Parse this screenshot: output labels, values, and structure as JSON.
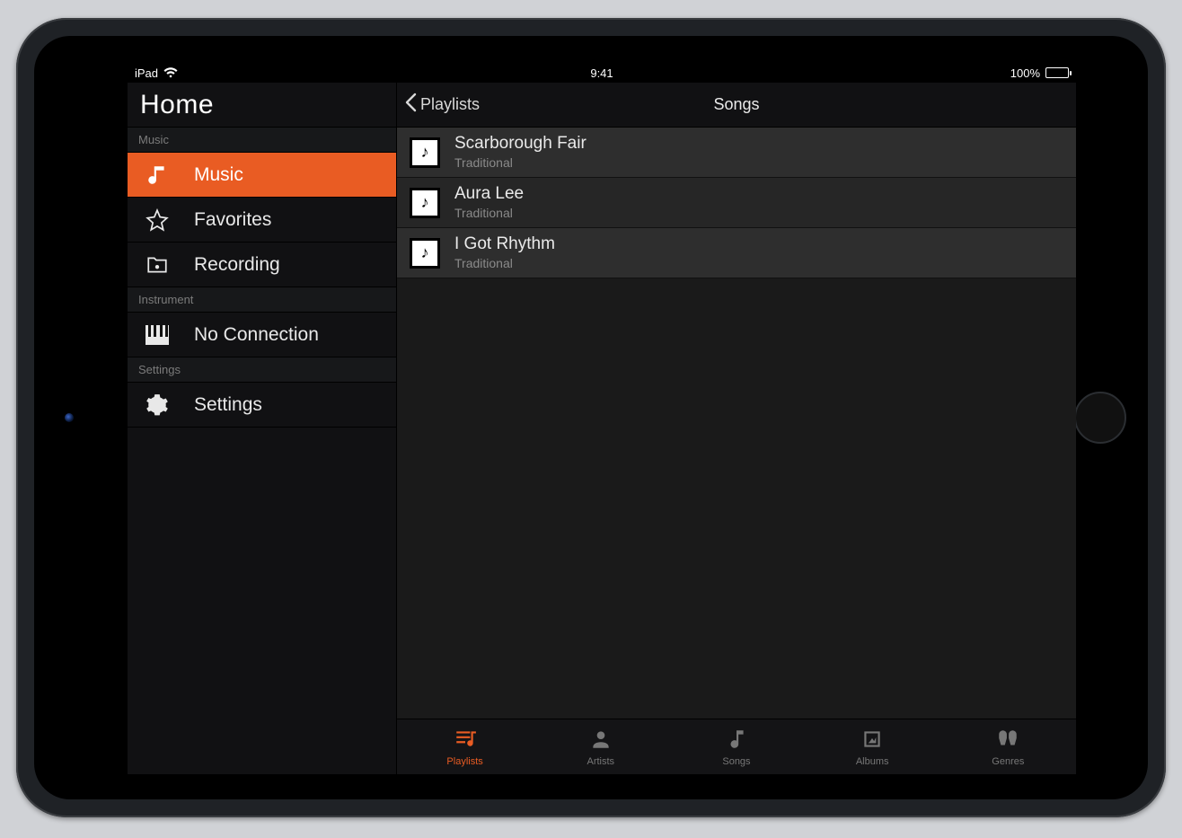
{
  "statusbar": {
    "device": "iPad",
    "time": "9:41",
    "battery_pct": "100%"
  },
  "sidebar": {
    "title": "Home",
    "sections": {
      "music_label": "Music",
      "instrument_label": "Instrument",
      "settings_label": "Settings"
    },
    "items": {
      "music": "Music",
      "favorites": "Favorites",
      "recording": "Recording",
      "no_connection": "No Connection",
      "settings": "Settings"
    }
  },
  "navbar": {
    "back_label": "Playlists",
    "title": "Songs"
  },
  "songs": [
    {
      "title": "Scarborough Fair",
      "subtitle": "Traditional"
    },
    {
      "title": "Aura Lee",
      "subtitle": "Traditional"
    },
    {
      "title": "I Got Rhythm",
      "subtitle": "Traditional"
    }
  ],
  "tabs": {
    "playlists": "Playlists",
    "artists": "Artists",
    "songs": "Songs",
    "albums": "Albums",
    "genres": "Genres"
  },
  "accent": "#e95c23"
}
